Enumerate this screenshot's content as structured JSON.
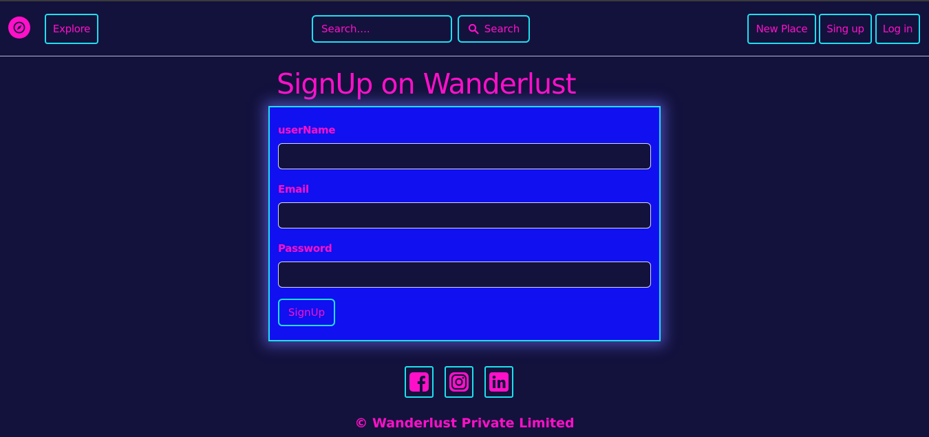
{
  "nav": {
    "logo_icon": "compass-icon",
    "explore_label": "Explore",
    "search_placeholder": "Search....",
    "search_button_label": "Search",
    "new_place_label": "New Place",
    "signup_label": "Sing up",
    "login_label": "Log in"
  },
  "page": {
    "title": "SignUp on Wanderlust"
  },
  "form": {
    "username_label": "userName",
    "email_label": "Email",
    "password_label": "Password",
    "submit_label": "SignUp"
  },
  "footer": {
    "social_icons": [
      "facebook-icon",
      "instagram-icon",
      "linkedin-icon"
    ],
    "copyright": "© Wanderlust Private Limited"
  },
  "colors": {
    "background": "#13123d",
    "accent_text": "#ff10c8",
    "border_accent": "#1fe0ee",
    "form_background": "#1010f0"
  }
}
